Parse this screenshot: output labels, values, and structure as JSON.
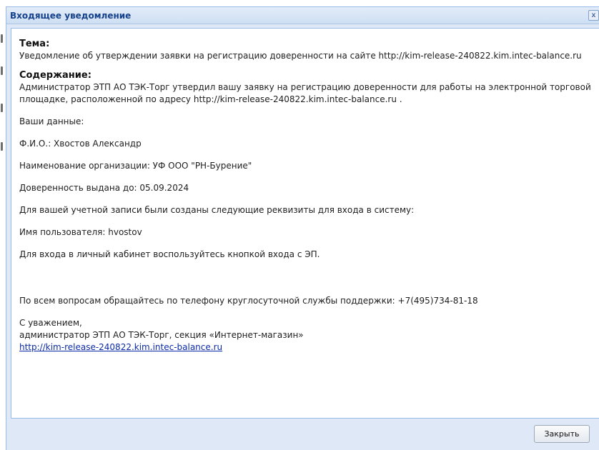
{
  "dialog": {
    "title": "Входящее уведомление",
    "close_glyph": "x",
    "close_icon": "close-icon"
  },
  "message": {
    "subject_label": "Тема:",
    "subject_text": "Уведомление об утверждении заявки на регистрацию доверенности на сайте http://kim-release-240822.kim.intec-balance.ru",
    "content_label": "Содержание:",
    "intro": "Администратор ЭТП АО ТЭК-Торг утвердил вашу заявку на регистрацию доверенности для работы на электронной торговой площадке, расположенной по адресу http://kim-release-240822.kim.intec-balance.ru .",
    "your_data": "Ваши данные:",
    "fio": "Ф.И.О.: Хвостов Александр",
    "organization": "Наименование организации: УФ ООО \"РН-Бурение\"",
    "valid_until": "Доверенность выдана до: 05.09.2024",
    "credentials_intro": "Для вашей учетной записи были созданы следующие реквизиты для входа в систему:",
    "username": "Имя пользователя: hvostov",
    "login_hint": "Для входа в личный кабинет воспользуйтесь кнопкой входа с ЭП.",
    "support": "По всем вопросам обращайтесь по телефону круглосуточной службы поддержки: +7(495)734-81-18",
    "regards": "С уважением,",
    "signature": "администратор ЭТП АО ТЭК-Торг, секция «Интернет-магазин»",
    "site_link": "http://kim-release-240822.kim.intec-balance.ru"
  },
  "footer": {
    "close_label": "Закрыть"
  },
  "colors": {
    "title_text": "#15428b",
    "frame": "#dfe8f6",
    "border": "#99bbe8",
    "link": "#0b2aa8"
  }
}
